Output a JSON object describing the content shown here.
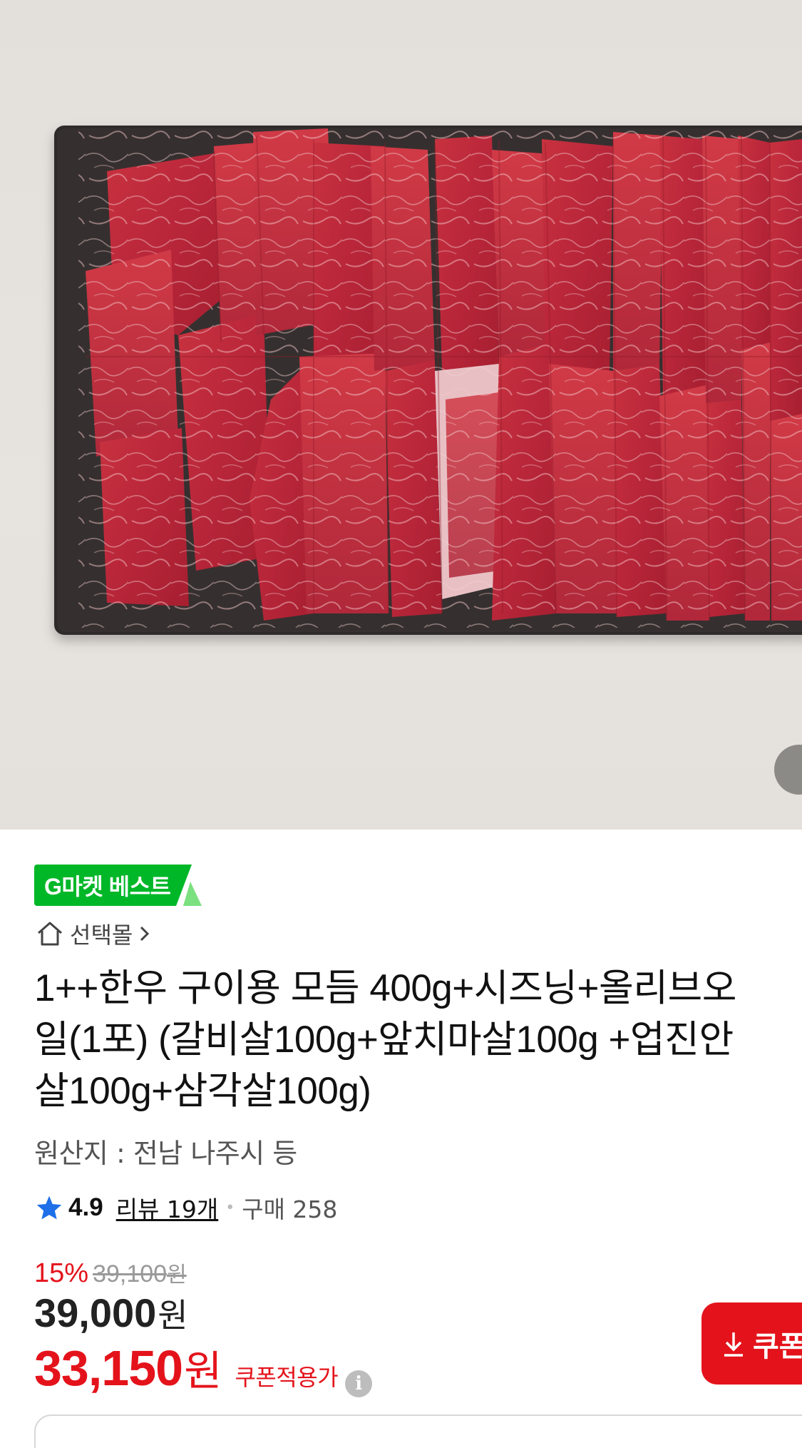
{
  "hero": {
    "image_description_icon": "product-photo-beef-cuts",
    "carousel_indicator_icon": "carousel-dot-icon"
  },
  "badge": {
    "label": "G마켓 베스트",
    "color": "#00b728"
  },
  "store": {
    "label": "선택몰",
    "home_icon": "home-icon",
    "chevron_icon": "chevron-right-icon"
  },
  "product": {
    "title_lines": [
      "1++한우 구이용 모듬 400g+시즈닝+올리브오",
      "일(1포) (갈비살100g+앞치마살100g +업진안",
      "살100g+삼각살100g)"
    ],
    "origin": "원산지 : 전남 나주시 등"
  },
  "rating": {
    "star_icon": "star-icon",
    "star_color": "#1e6fe8",
    "score": "4.9",
    "review_label": "리뷰 19개",
    "purchase_label": "구매 258"
  },
  "price": {
    "discount_rate": "15%",
    "original_price": "39,100",
    "original_unit": "원",
    "sale_price": "39,000",
    "sale_unit": "원",
    "coupon_price": "33,150",
    "coupon_unit": "원",
    "coupon_label": "쿠폰적용가",
    "info_icon": "i",
    "accent_color": "#e4131b"
  },
  "coupon_button": {
    "label": "쿠폰",
    "icon": "download-icon"
  }
}
